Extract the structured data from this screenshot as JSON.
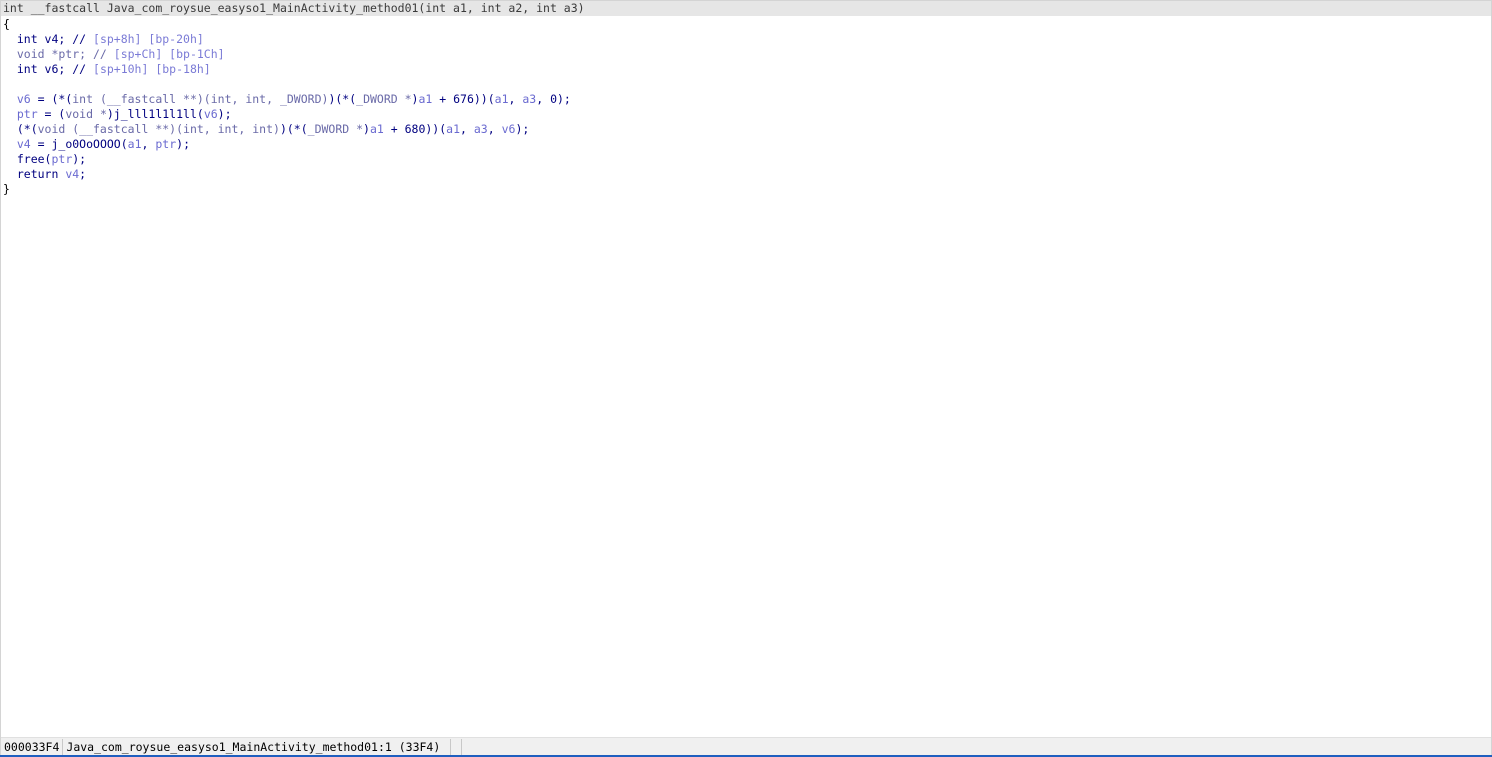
{
  "signature": "int __fastcall Java_com_roysue_easyso1_MainActivity_method01(int a1, int a2, int a3)",
  "code": {
    "open_brace": "{",
    "close_brace": "}",
    "lines": [
      [
        {
          "t": "kw",
          "v": "  int v4; // "
        },
        {
          "t": "off",
          "v": "[sp+8h] [bp-20h]"
        }
      ],
      [
        {
          "t": "cast",
          "v": "  void *ptr; // "
        },
        {
          "t": "off",
          "v": "[sp+Ch] [bp-1Ch]"
        }
      ],
      [
        {
          "t": "kw",
          "v": "  int v6; // "
        },
        {
          "t": "off",
          "v": "[sp+10h] [bp-18h]"
        }
      ],
      [
        {
          "t": "p",
          "v": ""
        }
      ],
      [
        {
          "t": "var",
          "v": "  v6"
        },
        {
          "t": "p",
          "v": " = (*("
        },
        {
          "t": "cast",
          "v": "int (__fastcall **)(int, int, _DWORD)"
        },
        {
          "t": "p",
          "v": ")(*("
        },
        {
          "t": "cast",
          "v": "_DWORD *"
        },
        {
          "t": "p",
          "v": ")"
        },
        {
          "t": "var",
          "v": "a1"
        },
        {
          "t": "p",
          "v": " + 676))("
        },
        {
          "t": "var",
          "v": "a1"
        },
        {
          "t": "p",
          "v": ", "
        },
        {
          "t": "var",
          "v": "a3"
        },
        {
          "t": "p",
          "v": ", 0);"
        }
      ],
      [
        {
          "t": "var",
          "v": "  ptr"
        },
        {
          "t": "p",
          "v": " = ("
        },
        {
          "t": "cast",
          "v": "void *"
        },
        {
          "t": "p",
          "v": ")j_lll1l1l1ll("
        },
        {
          "t": "var",
          "v": "v6"
        },
        {
          "t": "p",
          "v": ");"
        }
      ],
      [
        {
          "t": "p",
          "v": "  (*("
        },
        {
          "t": "cast",
          "v": "void (__fastcall **)(int, int, int)"
        },
        {
          "t": "p",
          "v": ")(*("
        },
        {
          "t": "cast",
          "v": "_DWORD *"
        },
        {
          "t": "p",
          "v": ")"
        },
        {
          "t": "var",
          "v": "a1"
        },
        {
          "t": "p",
          "v": " + 680))("
        },
        {
          "t": "var",
          "v": "a1"
        },
        {
          "t": "p",
          "v": ", "
        },
        {
          "t": "var",
          "v": "a3"
        },
        {
          "t": "p",
          "v": ", "
        },
        {
          "t": "var",
          "v": "v6"
        },
        {
          "t": "p",
          "v": ");"
        }
      ],
      [
        {
          "t": "var",
          "v": "  v4"
        },
        {
          "t": "p",
          "v": " = j_o0OoOOOO("
        },
        {
          "t": "var",
          "v": "a1"
        },
        {
          "t": "p",
          "v": ", "
        },
        {
          "t": "var",
          "v": "ptr"
        },
        {
          "t": "p",
          "v": ");"
        }
      ],
      [
        {
          "t": "p",
          "v": "  free("
        },
        {
          "t": "var",
          "v": "ptr"
        },
        {
          "t": "p",
          "v": ");"
        }
      ],
      [
        {
          "t": "p",
          "v": "  return "
        },
        {
          "t": "var",
          "v": "v4"
        },
        {
          "t": "p",
          "v": ";"
        }
      ]
    ]
  },
  "statusbar": {
    "address": "000033F4",
    "location": "Java_com_roysue_easyso1_MainActivity_method01:1 (33F4)"
  },
  "colors": {
    "keyword": "#000080",
    "variable": "#6a6ad0",
    "offset_comment": "#7b7bd6",
    "signature_bg": "#e6e6e6",
    "statusbar_bg": "#f0f0f0",
    "accent_bottom": "#1f5fbf"
  }
}
